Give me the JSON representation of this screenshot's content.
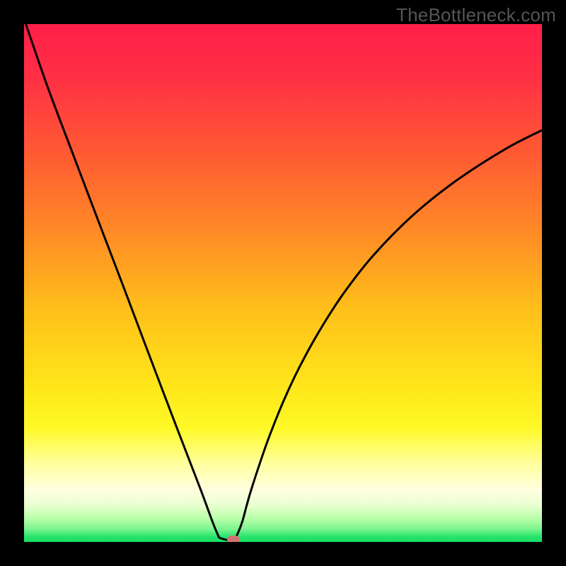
{
  "watermark": "TheBottleneck.com",
  "colors": {
    "gradient_stops": [
      {
        "pos": 0.0,
        "color": "#ff1f49"
      },
      {
        "pos": 0.1,
        "color": "#ff2f45"
      },
      {
        "pos": 0.25,
        "color": "#ff5a33"
      },
      {
        "pos": 0.4,
        "color": "#ff8a26"
      },
      {
        "pos": 0.55,
        "color": "#ffbf1a"
      },
      {
        "pos": 0.7,
        "color": "#ffe61a"
      },
      {
        "pos": 0.78,
        "color": "#fff927"
      },
      {
        "pos": 0.85,
        "color": "#ffffa0"
      },
      {
        "pos": 0.9,
        "color": "#ffffe0"
      },
      {
        "pos": 0.93,
        "color": "#e8ffd0"
      },
      {
        "pos": 0.955,
        "color": "#b8ffa8"
      },
      {
        "pos": 0.975,
        "color": "#7cf58f"
      },
      {
        "pos": 0.99,
        "color": "#27e36c"
      },
      {
        "pos": 1.0,
        "color": "#17df65"
      }
    ],
    "curve": "#000000",
    "marker": "#cf7472"
  },
  "chart_data": {
    "type": "line",
    "title": "",
    "xlabel": "",
    "ylabel": "",
    "xlim": [
      0,
      100
    ],
    "ylim": [
      0,
      100
    ],
    "grid": false,
    "series": [
      {
        "name": "bottleneck-curve-left",
        "x": [
          0.0,
          4.5,
          9.4,
          14.3,
          19.3,
          24.2,
          29.1,
          34.1,
          36.5,
          37.5,
          37.7,
          38.1,
          39.1,
          40.4
        ],
        "values": [
          101,
          88.0,
          75.0,
          62.1,
          49.0,
          36.0,
          23.1,
          10.1,
          3.6,
          1.2,
          0.82,
          0.68,
          0.41,
          0.41
        ]
      },
      {
        "name": "bottleneck-curve-right",
        "x": [
          40.4,
          41.0,
          42.1,
          43.0,
          43.9,
          45.7,
          47.4,
          50.1,
          53.1,
          57.0,
          61.7,
          67.5,
          75.1,
          83.5,
          93.0,
          100.0
        ],
        "values": [
          0.41,
          1.1,
          3.8,
          7.1,
          10.2,
          15.7,
          20.5,
          27.2,
          33.6,
          40.7,
          48.0,
          55.4,
          63.1,
          69.8,
          75.9,
          79.5
        ]
      }
    ],
    "annotations": [
      {
        "name": "min-marker",
        "x": 40.4,
        "y": 0.41
      }
    ]
  }
}
